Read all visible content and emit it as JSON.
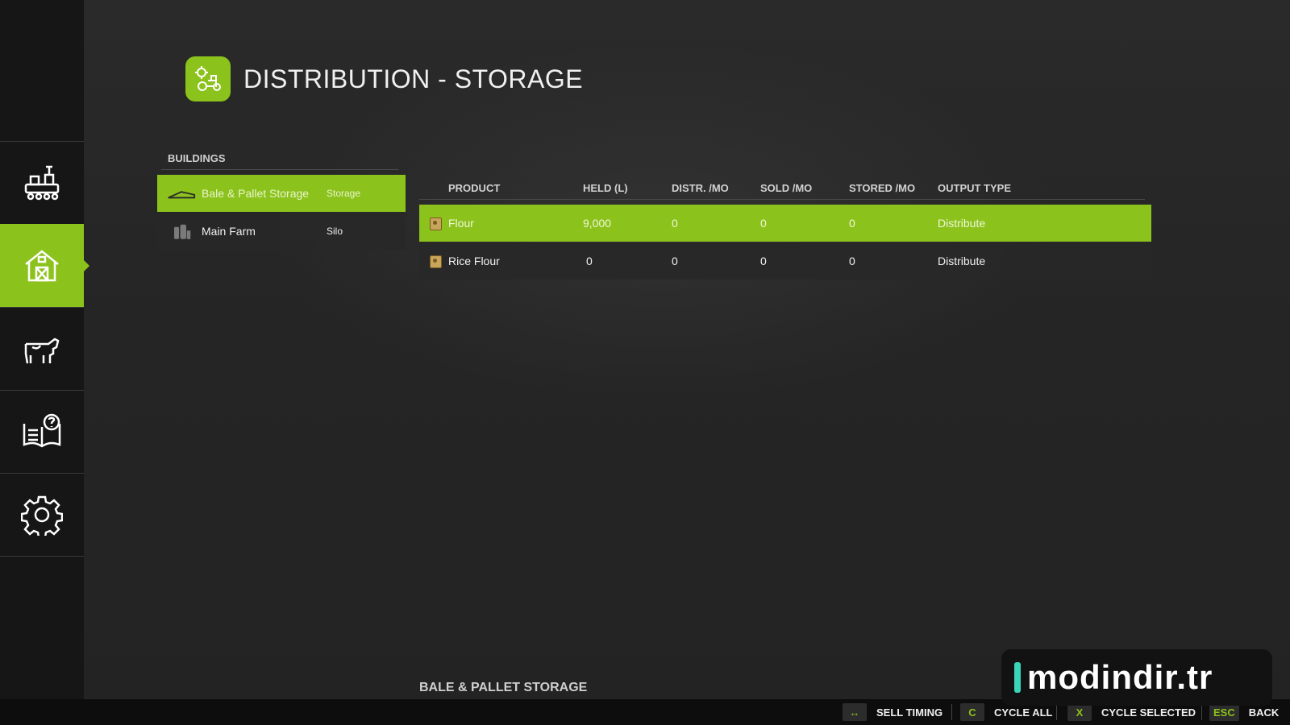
{
  "header": {
    "title": "DISTRIBUTION - STORAGE",
    "icon": "tractor-gear-icon"
  },
  "sidebar": {
    "items": [
      {
        "icon": "production-icon",
        "active": false
      },
      {
        "icon": "barn-icon",
        "active": true
      },
      {
        "icon": "cow-icon",
        "active": false
      },
      {
        "icon": "help-book-icon",
        "active": false
      },
      {
        "icon": "gear-icon",
        "active": false
      }
    ]
  },
  "buildings": {
    "title": "BUILDINGS",
    "items": [
      {
        "name": "Bale & Pallet Storage",
        "type": "Storage",
        "selected": true,
        "icon": "storage-shed-icon"
      },
      {
        "name": "Main Farm",
        "type": "Silo",
        "selected": false,
        "icon": "silo-icon"
      }
    ]
  },
  "products": {
    "headers": [
      "PRODUCT",
      "HELD (L)",
      "DISTR. /MO",
      "SOLD /MO",
      "STORED /MO",
      "OUTPUT TYPE"
    ],
    "rows": [
      {
        "product": "Flour",
        "held": "9,000",
        "distr": "0",
        "sold": "0",
        "stored": "0",
        "output": "Distribute",
        "selected": true,
        "icon": "flour-bag-icon"
      },
      {
        "product": "Rice Flour",
        "held": "0",
        "distr": "0",
        "sold": "0",
        "stored": "0",
        "output": "Distribute",
        "selected": false,
        "icon": "rice-flour-bag-icon"
      }
    ]
  },
  "footer": {
    "selected_building": "BALE & PALLET STORAGE"
  },
  "hints": [
    {
      "key": "↔",
      "label": "SELL TIMING"
    },
    {
      "key": "C",
      "label": "CYCLE ALL"
    },
    {
      "key": "X",
      "label": "CYCLE SELECTED"
    },
    {
      "key": "ESC",
      "label": "BACK"
    }
  ],
  "watermark": {
    "text": "modindir.tr"
  },
  "colors": {
    "accent": "#8cc21c",
    "sidebar": "#161616",
    "background": "#262626"
  }
}
